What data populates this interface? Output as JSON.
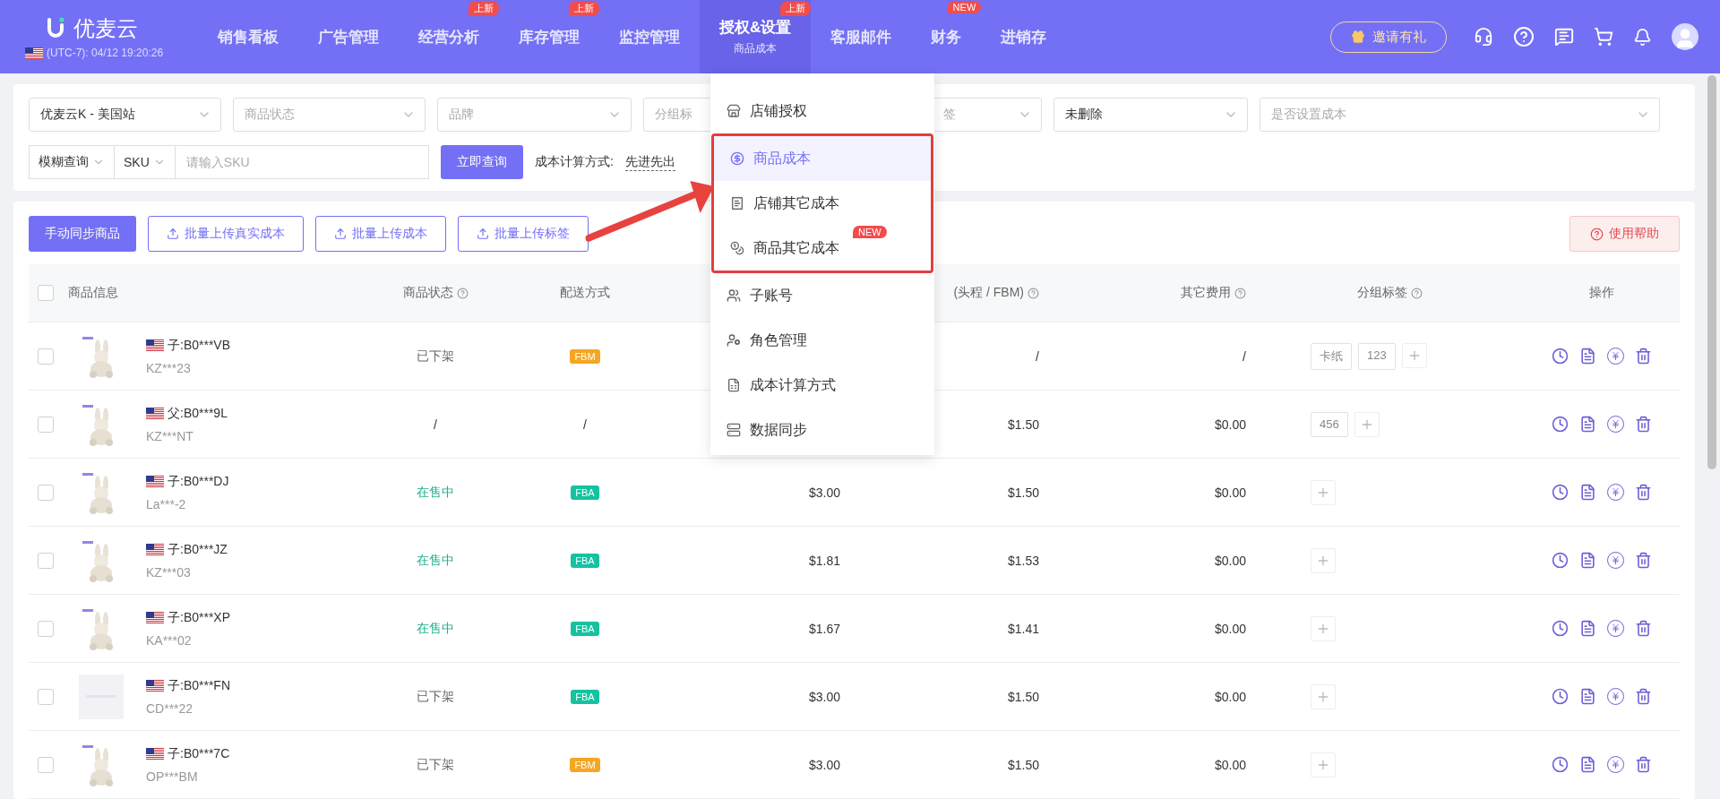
{
  "header": {
    "logo_text": "优麦云",
    "clock": "(UTC-7): 04/12 19:20:26",
    "nav": [
      {
        "label": "销售看板",
        "selected": false
      },
      {
        "label": "广告管理",
        "selected": false
      },
      {
        "label": "经营分析",
        "selected": false,
        "badge": "上新"
      },
      {
        "label": "库存管理",
        "selected": false,
        "badge": "上新"
      },
      {
        "label": "监控管理",
        "selected": false
      },
      {
        "label": "授权&设置",
        "selected": true,
        "badge": "上新",
        "sub": "商品成本"
      },
      {
        "label": "客服邮件",
        "selected": false
      },
      {
        "label": "财务",
        "selected": false,
        "badge": "NEW"
      },
      {
        "label": "进销存",
        "selected": false
      }
    ],
    "invite": "邀请有礼"
  },
  "filters": {
    "row1": [
      {
        "text": "优麦云K - 美国站",
        "kind": "value"
      },
      {
        "text": "商品状态",
        "kind": "hint"
      },
      {
        "text": "品牌",
        "kind": "hint"
      },
      {
        "text": "分组标",
        "kind": "cut"
      },
      {
        "text": "签",
        "kind": "covered"
      },
      {
        "text": "未删除",
        "kind": "value"
      },
      {
        "text": "是否设置成本",
        "kind": "hint"
      }
    ],
    "match_mode": "模糊查询",
    "field": "SKU",
    "search": {
      "placeholder": "请输入SKU"
    },
    "query_button": "立即查询",
    "cost_label": "成本计算方式:",
    "cost_method": "先进先出"
  },
  "toolbar": {
    "sync_button": "手动同步商品",
    "upload_buttons": [
      "批量上传真实成本",
      "批量上传成本",
      "批量上传标签"
    ],
    "help_button": "使用帮助"
  },
  "table": {
    "header_checked": false,
    "columns": [
      {
        "label": "商品信息",
        "help": false
      },
      {
        "label": "商品状态",
        "help": true
      },
      {
        "label": "配送方式",
        "help": false
      },
      {
        "label": "(头程 / FBM)",
        "help": true
      },
      {
        "label": "其它费用",
        "help": true
      },
      {
        "label": "分组标签",
        "help": true
      },
      {
        "label": "操作",
        "help": false
      }
    ],
    "rows": [
      {
        "checked": false,
        "image": {
          "kind": "picture"
        },
        "asin": "子:B0***VB",
        "sku": "KZ***23",
        "status": {
          "text": "已下架",
          "kind": "off"
        },
        "shipping": {
          "text": "FBM",
          "kind": "fbm"
        },
        "purchase": null,
        "freight": "/",
        "other": "/",
        "tags": [
          "卡纸",
          "123"
        ]
      },
      {
        "checked": false,
        "image": {
          "kind": "picture"
        },
        "asin": "父:B0***9L",
        "sku": "KZ***NT",
        "status": {
          "text": "/",
          "kind": "none"
        },
        "shipping": {
          "text": "/",
          "kind": "none"
        },
        "purchase": null,
        "freight": "$1.50",
        "other": "$0.00",
        "tags": [
          "456"
        ]
      },
      {
        "checked": false,
        "image": {
          "kind": "picture"
        },
        "asin": "子:B0***DJ",
        "sku": "La***-2",
        "status": {
          "text": "在售中",
          "kind": "on"
        },
        "shipping": {
          "text": "FBA",
          "kind": "fba"
        },
        "purchase": "$3.00",
        "freight": "$1.50",
        "other": "$0.00",
        "tags": []
      },
      {
        "checked": false,
        "image": {
          "kind": "picture"
        },
        "asin": "子:B0***JZ",
        "sku": "KZ***03",
        "status": {
          "text": "在售中",
          "kind": "on"
        },
        "shipping": {
          "text": "FBA",
          "kind": "fba"
        },
        "purchase": "$1.81",
        "freight": "$1.53",
        "other": "$0.00",
        "tags": []
      },
      {
        "checked": false,
        "image": {
          "kind": "picture"
        },
        "asin": "子:B0***XP",
        "sku": "KA***02",
        "status": {
          "text": "在售中",
          "kind": "on"
        },
        "shipping": {
          "text": "FBA",
          "kind": "fba"
        },
        "purchase": "$1.67",
        "freight": "$1.41",
        "other": "$0.00",
        "tags": []
      },
      {
        "checked": false,
        "image": {
          "kind": "blank"
        },
        "asin": "子:B0***FN",
        "sku": "CD***22",
        "status": {
          "text": "已下架",
          "kind": "off"
        },
        "shipping": {
          "text": "FBA",
          "kind": "fba"
        },
        "purchase": "$3.00",
        "freight": "$1.50",
        "other": "$0.00",
        "tags": []
      },
      {
        "checked": false,
        "image": {
          "kind": "picture"
        },
        "asin": "子:B0***7C",
        "sku": "OP***BM",
        "status": {
          "text": "已下架",
          "kind": "off"
        },
        "shipping": {
          "text": "FBM",
          "kind": "fbm"
        },
        "purchase": "$3.00",
        "freight": "$1.50",
        "other": "$0.00",
        "tags": []
      }
    ]
  },
  "menu": {
    "items": [
      {
        "label": "店铺授权",
        "kind": "store",
        "selected": false
      },
      {
        "label": "商品成本",
        "kind": "cost",
        "selected": true
      },
      {
        "label": "店铺其它成本",
        "kind": "receipt",
        "selected": false
      },
      {
        "label": "商品其它成本",
        "kind": "coins",
        "selected": false,
        "badge": "NEW"
      },
      {
        "label": "子账号",
        "kind": "users",
        "selected": false
      },
      {
        "label": "角色管理",
        "kind": "role",
        "selected": false
      },
      {
        "label": "成本计算方式",
        "kind": "doc",
        "selected": false
      },
      {
        "label": "数据同步",
        "kind": "sync",
        "selected": false
      }
    ]
  }
}
